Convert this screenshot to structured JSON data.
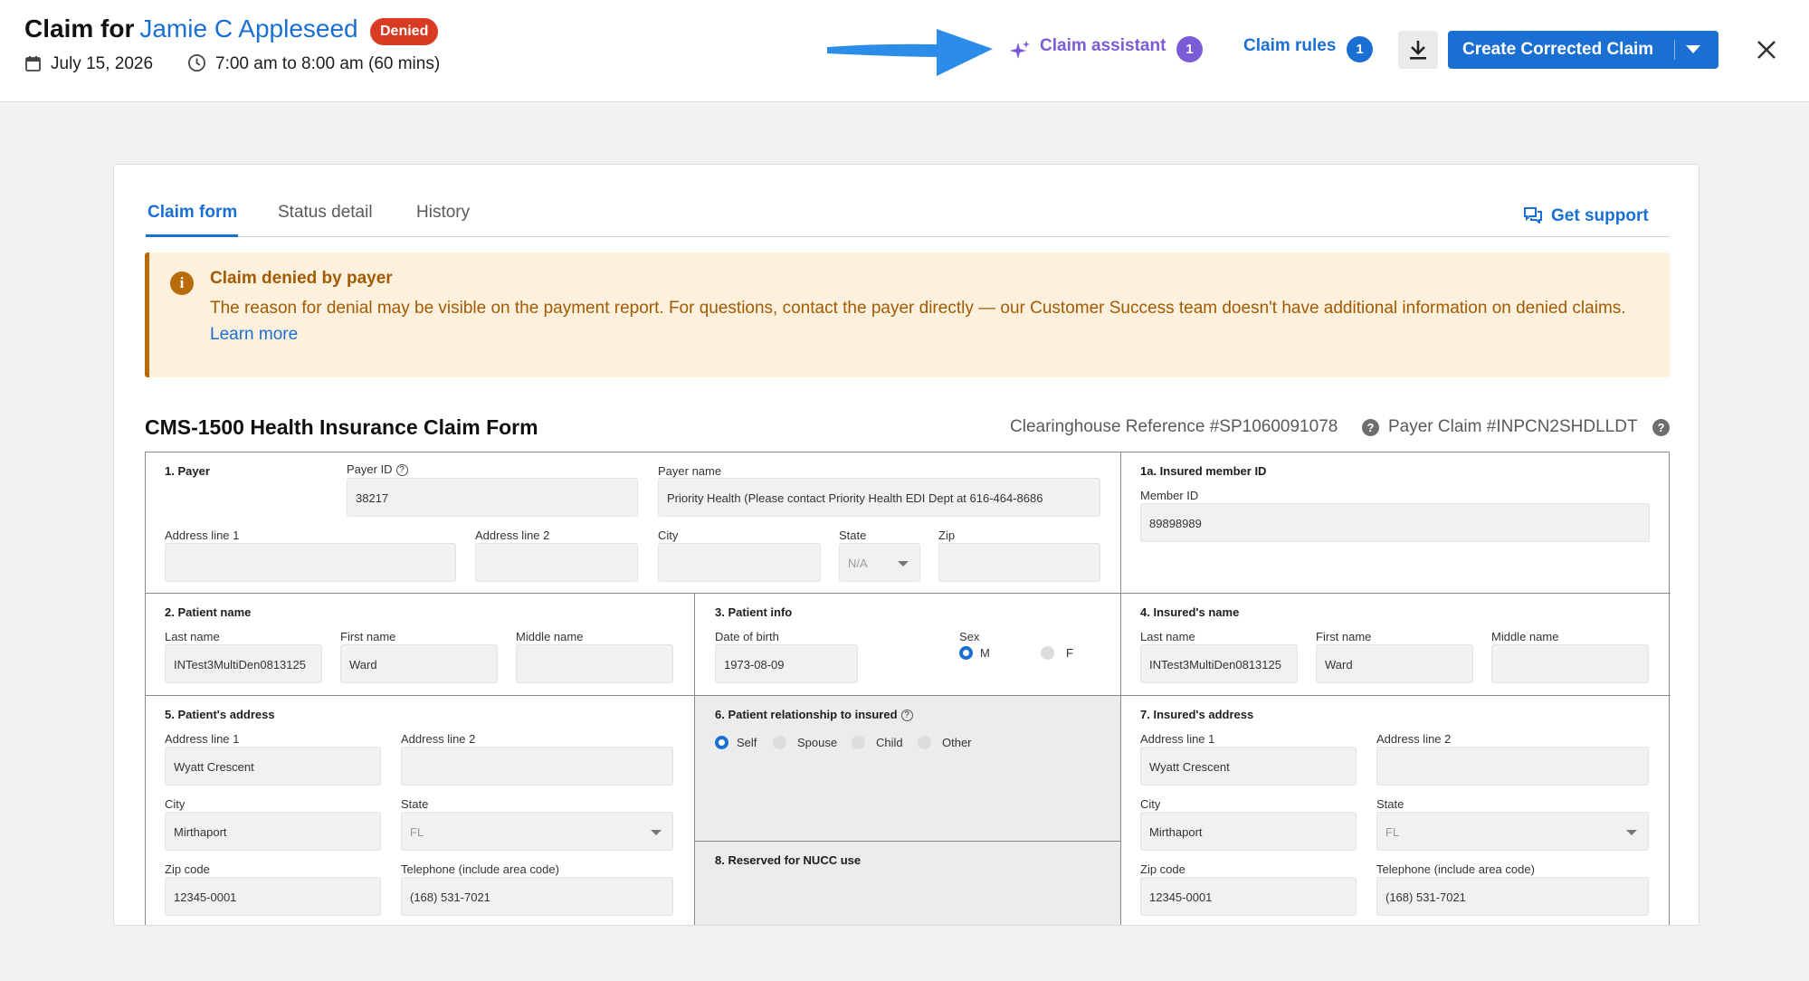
{
  "header": {
    "title_prefix": "Claim for",
    "patient_name": "Jamie C Appleseed",
    "status_badge": "Denied",
    "date": "July 15, 2026",
    "time": "7:00 am to 8:00 am (60 mins)",
    "claim_assistant": {
      "label": "Claim assistant",
      "count": "1"
    },
    "claim_rules": {
      "label": "Claim rules",
      "count": "1"
    },
    "create_corrected_claim": "Create Corrected Claim"
  },
  "tabs": [
    {
      "label": "Claim form"
    },
    {
      "label": "Status detail"
    },
    {
      "label": "History"
    }
  ],
  "get_support": "Get support",
  "alert": {
    "title": "Claim denied by payer",
    "body": "The reason for denial may be visible on the payment report. For questions, contact the payer directly — our Customer Success team doesn't have additional information on denied claims.",
    "link": "Learn more"
  },
  "form": {
    "title": "CMS-1500 Health Insurance Claim Form",
    "clearinghouse_ref": "Clearinghouse Reference #SP1060091078",
    "payer_claim": "Payer Claim #INPCN2SHDLLDT",
    "payer": {
      "heading": "1. Payer",
      "payer_id_label": "Payer ID",
      "payer_id": "38217",
      "payer_name_label": "Payer name",
      "payer_name": "Priority Health (Please contact Priority Health EDI Dept at 616-464-8686",
      "address1_label": "Address line 1",
      "address2_label": "Address line 2",
      "city_label": "City",
      "state_label": "State",
      "state": "N/A",
      "zip_label": "Zip"
    },
    "insured_member": {
      "heading": "1a. Insured member ID",
      "label": "Member ID",
      "value": "89898989"
    },
    "patient_name": {
      "heading": "2. Patient name",
      "last_label": "Last name",
      "last": "INTest3MultiDen0813125",
      "first_label": "First name",
      "first": "Ward",
      "middle_label": "Middle name",
      "middle": ""
    },
    "patient_info": {
      "heading": "3. Patient info",
      "dob_label": "Date of birth",
      "dob": "1973-08-09",
      "sex_label": "Sex",
      "sex_m": "M",
      "sex_f": "F",
      "selected": "M"
    },
    "insured_name": {
      "heading": "4. Insured's name",
      "last_label": "Last name",
      "last": "INTest3MultiDen0813125",
      "first_label": "First name",
      "first": "Ward",
      "middle_label": "Middle name",
      "middle": ""
    },
    "patient_address": {
      "heading": "5. Patient's address",
      "address1_label": "Address line 1",
      "address1": "Wyatt Crescent",
      "address2_label": "Address line 2",
      "address2": "",
      "city_label": "City",
      "city": "Mirthaport",
      "state_label": "State",
      "state": "FL",
      "zip_label": "Zip code",
      "zip": "12345-0001",
      "phone_label": "Telephone (include area code)",
      "phone": "(168) 531-7021"
    },
    "relationship": {
      "heading": "6. Patient relationship to insured",
      "options": [
        "Self",
        "Spouse",
        "Child",
        "Other"
      ],
      "selected": "Self"
    },
    "reserved": {
      "heading": "8. Reserved for NUCC use"
    },
    "insured_address": {
      "heading": "7. Insured's address",
      "address1_label": "Address line 1",
      "address1": "Wyatt Crescent",
      "address2_label": "Address line 2",
      "address2": "",
      "city_label": "City",
      "city": "Mirthaport",
      "state_label": "State",
      "state": "FL",
      "zip_label": "Zip code",
      "zip": "12345-0001",
      "phone_label": "Telephone (include area code)",
      "phone": "(168) 531-7021"
    }
  },
  "colors": {
    "primary": "#1a6fd3",
    "denied_badge": "#d83a22",
    "assistant_purple": "#7c5cd6",
    "alert_bg": "#fdf0dc",
    "alert_text": "#a15b04"
  }
}
